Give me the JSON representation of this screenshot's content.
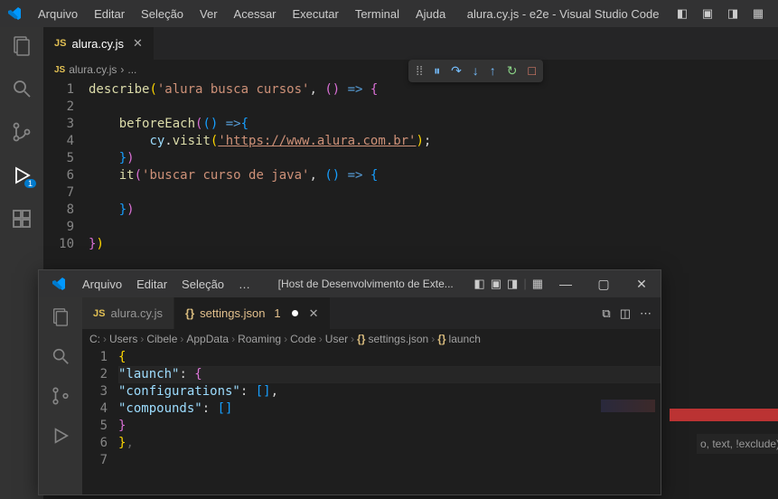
{
  "titlebar": {
    "menus": [
      "Arquivo",
      "Editar",
      "Seleção",
      "Ver",
      "Acessar",
      "Executar",
      "Terminal",
      "Ajuda"
    ],
    "title": "alura.cy.js - e2e - Visual Studio Code"
  },
  "activity": {
    "badge": "1"
  },
  "editor": {
    "tab": {
      "label": "alura.cy.js"
    },
    "breadcrumb": {
      "file": "alura.cy.js",
      "sep": "›",
      "more": "..."
    },
    "lines": [
      "1",
      "2",
      "3",
      "4",
      "5",
      "6",
      "7",
      "8",
      "9",
      "10"
    ],
    "code": {
      "l1": {
        "fn": "describe",
        "str": "'alura busca cursos'"
      },
      "l3": {
        "fn": "beforeEach"
      },
      "l4": {
        "obj": "cy",
        "fn": "visit",
        "url": "'https://www.alura.com.br'"
      },
      "l6": {
        "fn": "it",
        "str": "'buscar curso de java'"
      }
    }
  },
  "debug": {
    "icons": [
      "⁞⁞",
      "⏸",
      "↷",
      "↓",
      "↑",
      "↻",
      "□"
    ],
    "colors": [
      "#aaa",
      "#75beff",
      "#75beff",
      "#75beff",
      "#75beff",
      "#89d185",
      "#f48771"
    ]
  },
  "subwindow": {
    "menus": [
      "Arquivo",
      "Editar",
      "Seleção",
      "…"
    ],
    "title": "[Host de Desenvolvimento de Exte...",
    "tabs": {
      "t1": {
        "label": "alura.cy.js"
      },
      "t2": {
        "label": "settings.json",
        "modcount": "1"
      }
    },
    "breadcrumb": [
      "C:",
      "Users",
      "Cibele",
      "AppData",
      "Roaming",
      "Code",
      "User",
      "settings.json",
      "launch"
    ],
    "gutter": [
      "1",
      "2",
      "3",
      "4",
      "5",
      "6",
      "7"
    ],
    "json": {
      "launch": "\"launch\"",
      "configs": "\"configurations\"",
      "compounds": "\"compounds\""
    },
    "peek": "o, text, !exclude)"
  }
}
